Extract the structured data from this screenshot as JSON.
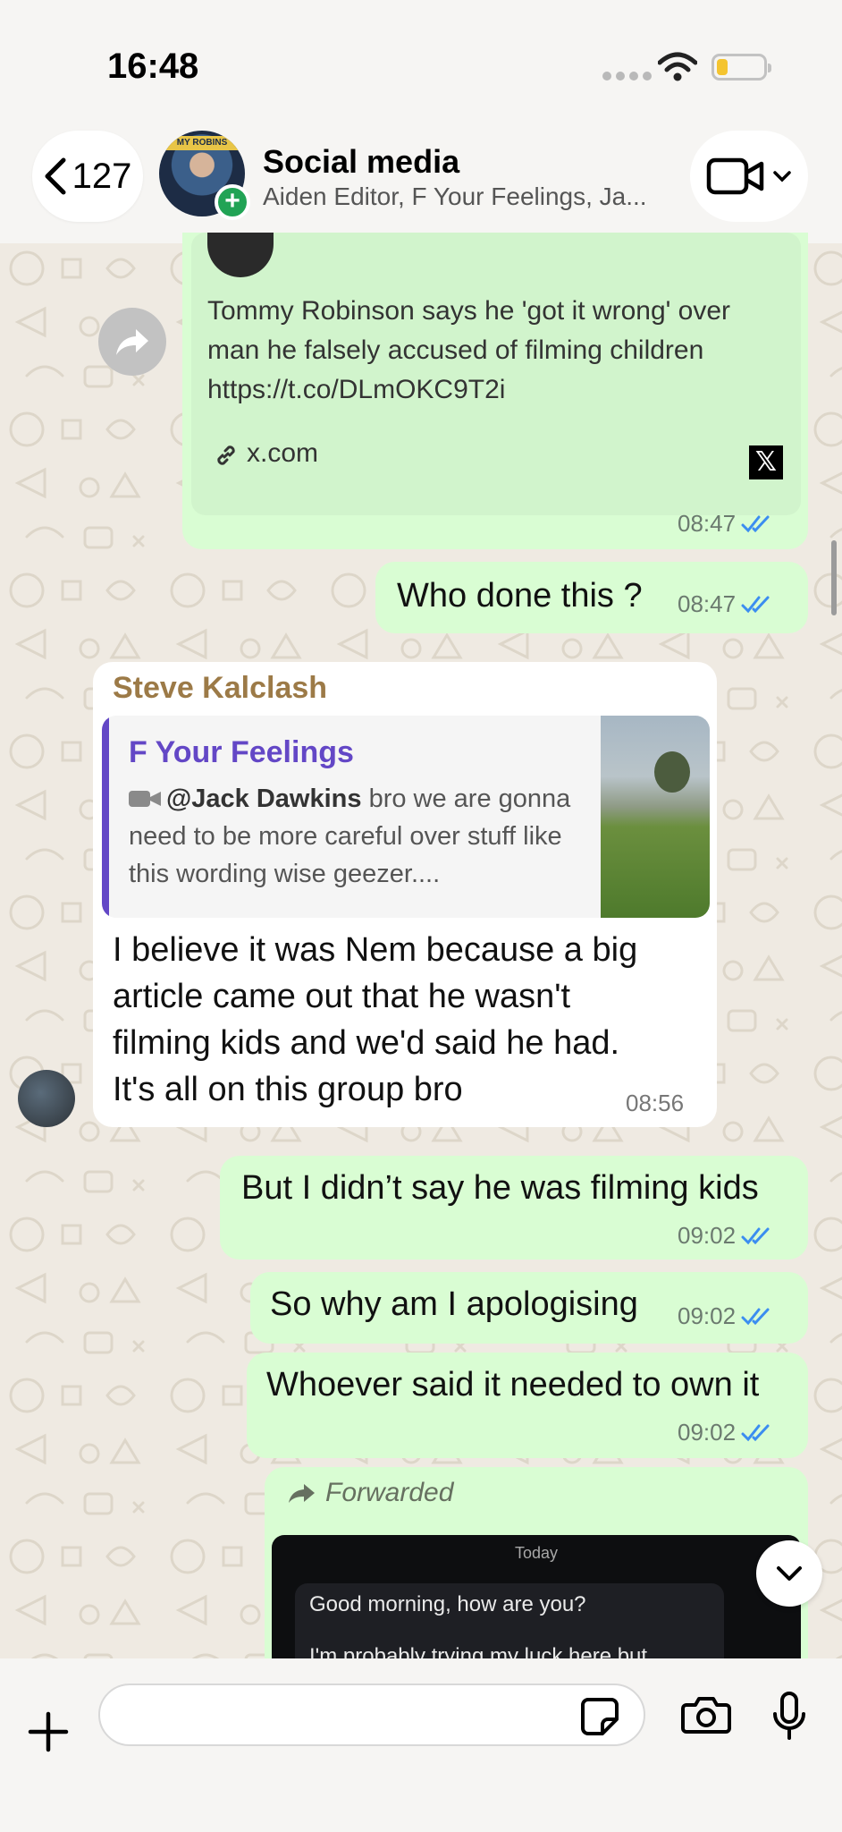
{
  "status_bar": {
    "time": "16:48"
  },
  "header": {
    "back_count": "127",
    "avatar_banner": "MY ROBINS",
    "title": "Social media",
    "subtitle": "Aiden Editor, F Your Feelings, Ja..."
  },
  "messages": {
    "link_message": {
      "description": "Tommy Robinson says he 'got it wrong' over man he falsely accused of filming children https://t.co/DLmOKC9T2i",
      "domain": "x.com",
      "brand_letter": "𝕏",
      "time": "08:47"
    },
    "msg_who_done": {
      "text": "Who done this ?",
      "time": "08:47"
    },
    "reply_message": {
      "sender": "Steve Kalclash",
      "quoted_author": "F Your Feelings",
      "quoted_mention": "@Jack Dawkins",
      "quoted_text": " bro we are gonna need to be more careful over stuff like this wording wise geezer....",
      "text": "I believe it was Nem because a big article came out that he wasn't filming kids and we'd said he had. It's all on this group bro",
      "time": "08:56"
    },
    "msg_didnt_say": {
      "text": "But I didn’t say he was filming kids",
      "time": "09:02"
    },
    "msg_why_apologising": {
      "text": "So why am I apologising",
      "time": "09:02"
    },
    "msg_own_it": {
      "text": "Whoever said it needed to own it",
      "time": "09:02"
    },
    "forwarded": {
      "label": "Forwarded",
      "screenshot_day": "Today",
      "screenshot_line1": "Good morning, how are you?",
      "screenshot_line2": "I'm probably trying my luck here but"
    }
  },
  "input": {
    "placeholder": "",
    "value": ""
  },
  "colors": {
    "outgoing_bubble": "#d9fdd3",
    "incoming_bubble": "#ffffff",
    "read_ticks": "#3b8df0",
    "sender_name": "#9c7a47",
    "quote_accent": "#6347c6",
    "online_plus": "#21a355"
  },
  "icons": {
    "back": "chevron-left-icon",
    "video": "video-camera-icon",
    "forward": "share-arrow-icon",
    "link": "link-icon",
    "read": "double-check-icon",
    "attach": "plus-icon",
    "sticker": "sticker-icon",
    "camera": "camera-icon",
    "mic": "microphone-icon",
    "scroll": "chevron-down-icon"
  }
}
